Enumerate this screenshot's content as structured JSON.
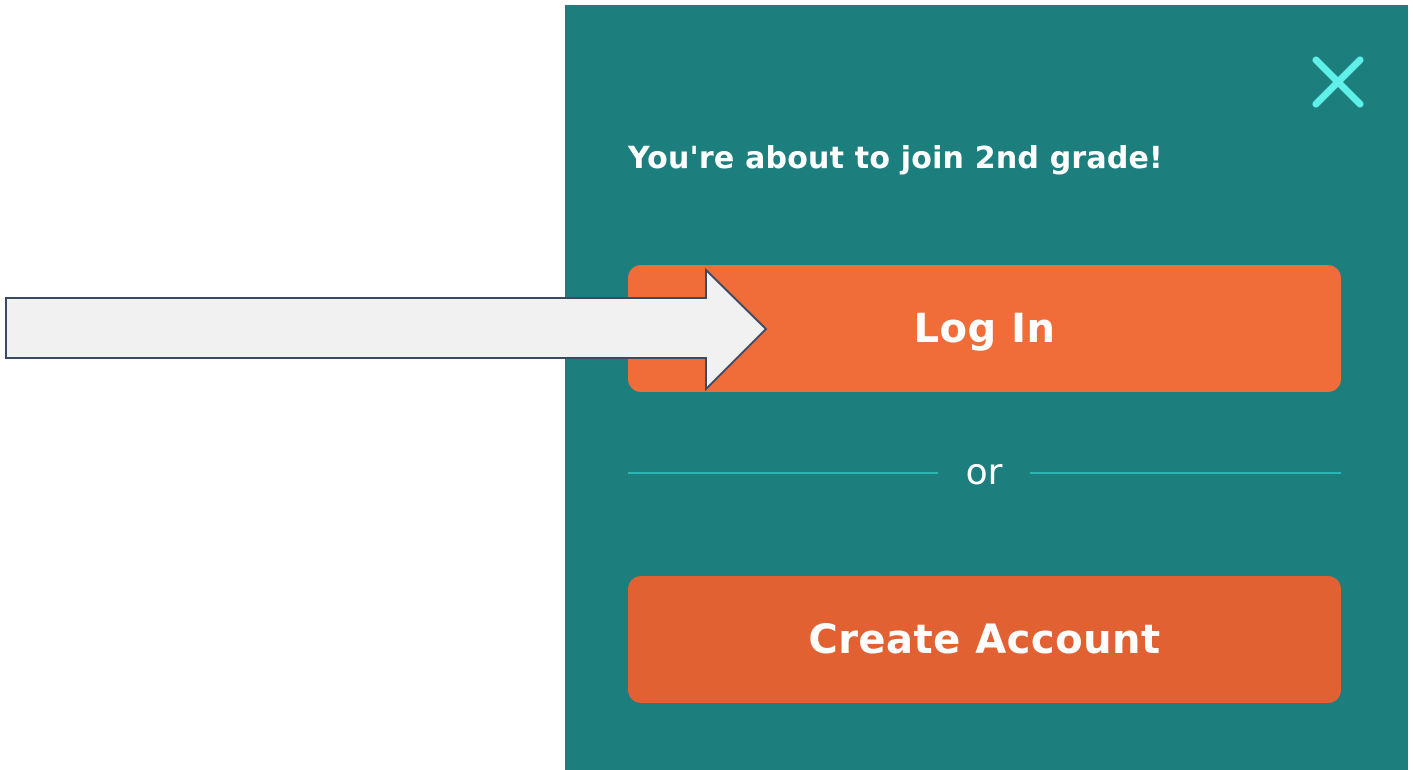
{
  "dialog": {
    "heading": "You're about to join 2nd grade!",
    "login_label": "Log In",
    "divider_text": "or",
    "create_account_label": "Create Account",
    "close_icon": "close-icon"
  },
  "colors": {
    "panel_background": "#1c7f7e",
    "login_button": "#f06d39",
    "create_account_button": "#e26132",
    "close_icon": "#5ff0ea",
    "divider_line": "#2bb6b5",
    "arrow_fill": "#f1f1f1",
    "arrow_stroke": "#3a4a63"
  },
  "annotation": {
    "icon": "right-arrow-pointer"
  }
}
